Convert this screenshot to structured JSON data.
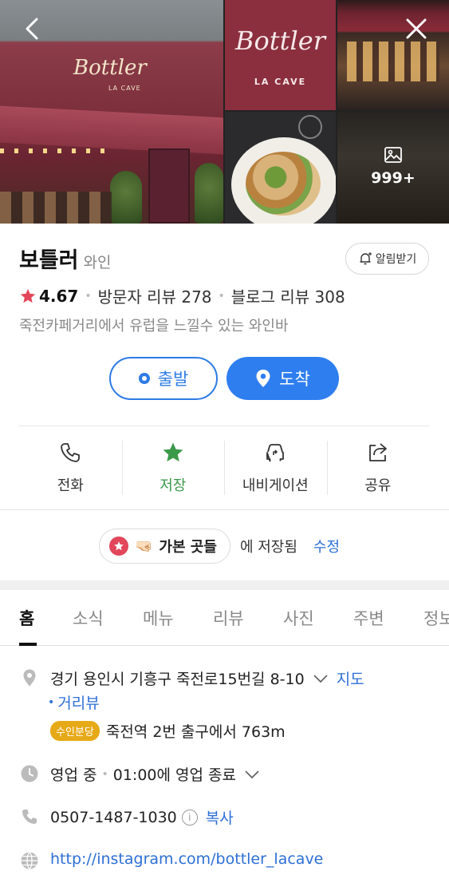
{
  "gallery": {
    "logo_script": "Bottler",
    "logo_sub": "LA CAVE",
    "photo_count": "999+"
  },
  "place": {
    "name": "보틀러",
    "category": "와인",
    "notify_label": "알림받기",
    "rating": "4.67",
    "visitor_reviews": "방문자 리뷰 278",
    "blog_reviews": "블로그 리뷰 308",
    "description": "죽전카페거리에서 유럽을 느낄수 있는 와인바"
  },
  "directions": {
    "start_label": "출발",
    "arrive_label": "도착"
  },
  "actions": [
    {
      "label": "전화"
    },
    {
      "label": "저장"
    },
    {
      "label": "내비게이션"
    },
    {
      "label": "공유"
    }
  ],
  "saved": {
    "emoji": "🤜🏻",
    "list_name": "가본 곳들",
    "suffix": "에 저장됨",
    "edit_label": "수정"
  },
  "tabs": [
    {
      "label": "홈"
    },
    {
      "label": "소식"
    },
    {
      "label": "메뉴"
    },
    {
      "label": "리뷰"
    },
    {
      "label": "사진"
    },
    {
      "label": "주변"
    },
    {
      "label": "정보"
    }
  ],
  "info": {
    "address": "경기 용인시 기흥구 죽전로15번길 8-10",
    "map_link": "지도",
    "street_view": "거리뷰",
    "station_line": "수인분당",
    "station_text": "죽전역 2번 출구에서 763m",
    "hours_status": "영업 중",
    "hours_detail": "01:00에 영업 종료",
    "phone": "0507-1487-1030",
    "copy_label": "복사",
    "website": "http://instagram.com/bottler_lacave"
  },
  "colors": {
    "accent_blue": "#2f7ef0",
    "star_red": "#e2465a",
    "save_green": "#3a9a4a",
    "station_yellow": "#e6a917"
  }
}
